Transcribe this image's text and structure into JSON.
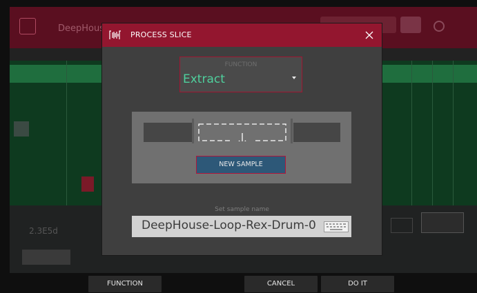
{
  "background": {
    "title": "DeepHouse",
    "value": "2.3E5d"
  },
  "dialog": {
    "title": "PROCESS SLICE",
    "icons": {
      "header": "waveform-icon",
      "close": "close-icon"
    },
    "function": {
      "label": "FUNCTION",
      "value": "Extract"
    },
    "preview": {
      "button_label": "NEW SAMPLE",
      "arrow_icon": "down-arrow-icon"
    },
    "sample_name": {
      "label": "Set sample name",
      "value": "DeepHouse-Loop-Rex-Drum-0",
      "keyboard_icon": "keyboard-icon"
    }
  },
  "bottom_bar": {
    "function_label": "FUNCTION",
    "cancel_label": "CANCEL",
    "doit_label": "DO IT"
  },
  "colors": {
    "accent_red": "#93162f",
    "accent_green": "#4fd09d",
    "button_blue": "#2d5878"
  }
}
